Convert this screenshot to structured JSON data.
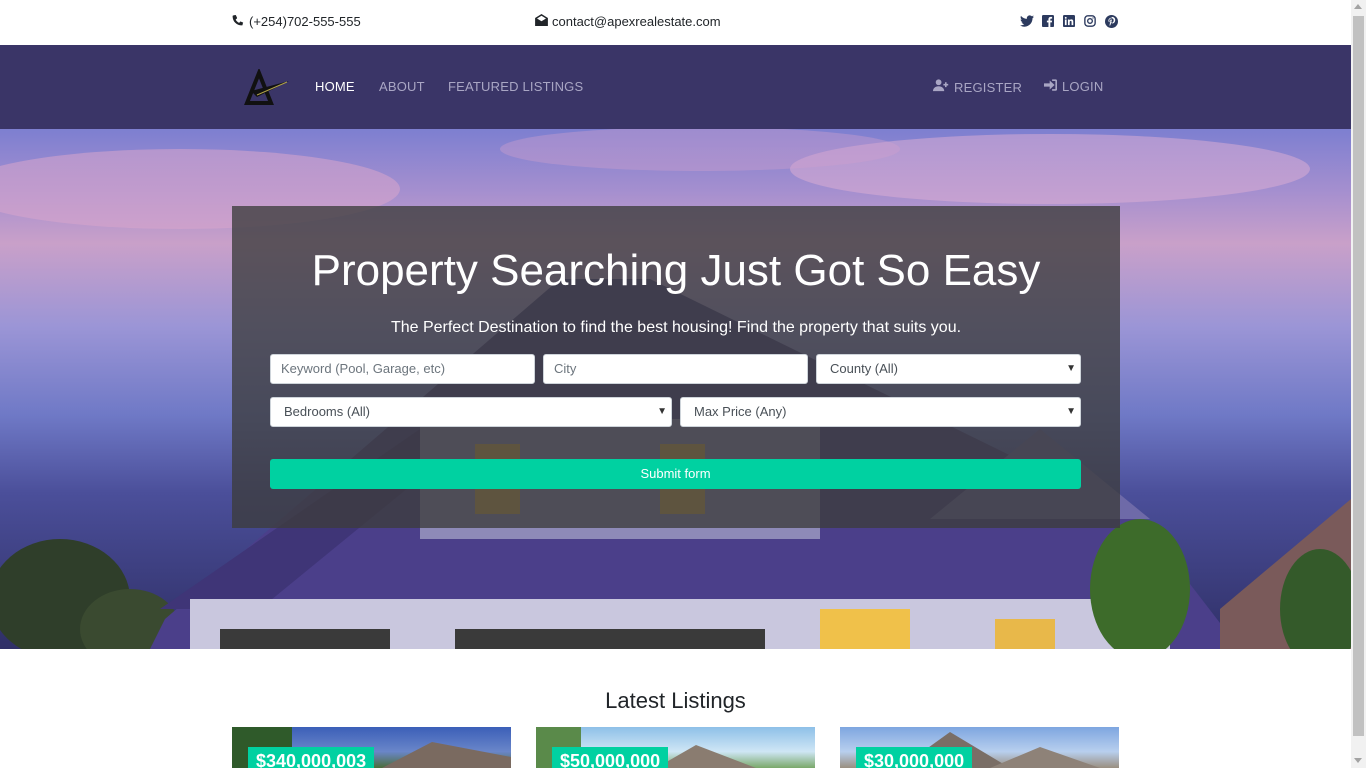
{
  "topbar": {
    "phone": "(+254)702-555-555",
    "email": "contact@apexrealestate.com",
    "social": [
      "twitter-icon",
      "facebook-icon",
      "linkedin-icon",
      "instagram-icon",
      "pinterest-icon"
    ]
  },
  "nav": {
    "links": [
      "HOME",
      "ABOUT",
      "FEATURED LISTINGS"
    ],
    "active": "HOME",
    "register": "REGISTER",
    "login": "LOGIN"
  },
  "hero": {
    "title": "Property Searching Just Got So Easy",
    "subtitle": "The Perfect Destination to find the best housing! Find the property that suits you.",
    "keyword_placeholder": "Keyword (Pool, Garage, etc)",
    "city_placeholder": "City",
    "county_selected": "County (All)",
    "bedrooms_selected": "Bedrooms (All)",
    "price_selected": "Max Price (Any)",
    "submit_label": "Submit form"
  },
  "latest": {
    "title": "Latest Listings",
    "listings": [
      {
        "price": "$340,000,003"
      },
      {
        "price": "$50,000,000"
      },
      {
        "price": "$30,000,000"
      }
    ]
  },
  "colors": {
    "navbar": "#3a3567",
    "accent": "#00d1a1"
  }
}
